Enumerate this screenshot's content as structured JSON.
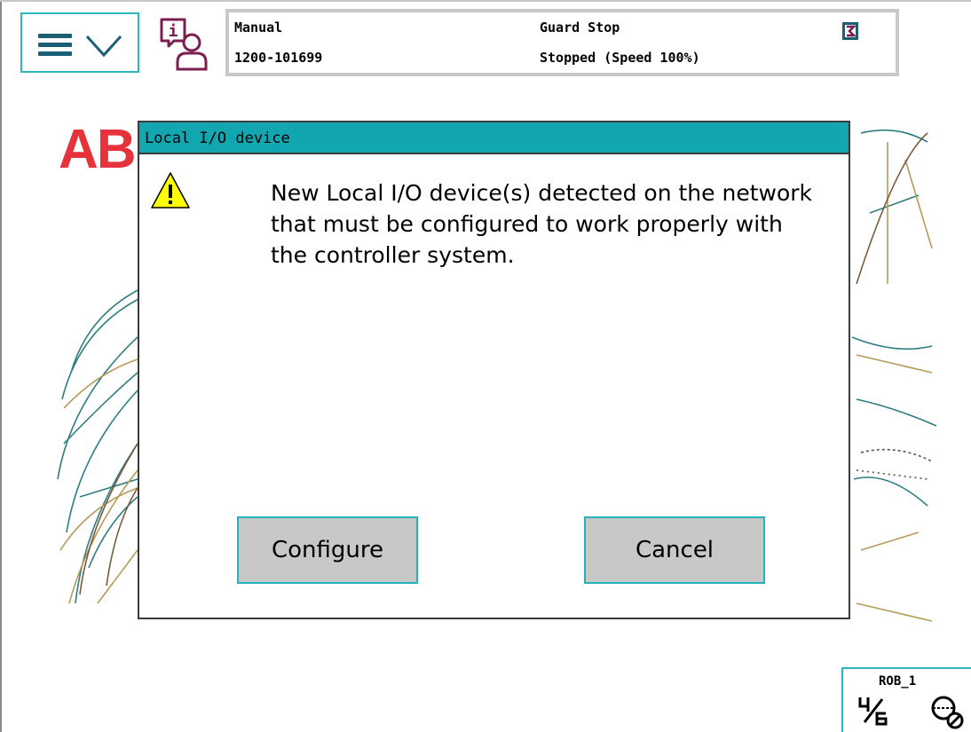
{
  "header": {
    "menu_button": {
      "icon": "hamburger-chevron-icon"
    },
    "info_button": {
      "icon": "info-user-icon"
    },
    "status": {
      "mode": "Manual",
      "system_id": "1200-101699",
      "state": "Guard Stop",
      "motion": "Stopped (Speed 100%)",
      "flag_icon": "status-flag-icon"
    }
  },
  "background": {
    "logo_text": "AB"
  },
  "dialog": {
    "title": "Local I/O device",
    "icon": "warning-icon",
    "message": "New Local I/O device(s) detected on the network that must be configured to work properly with the controller system.",
    "buttons": {
      "configure": "Configure",
      "cancel": "Cancel"
    }
  },
  "robot": {
    "label": "ROB_1",
    "frac_icon": "axes-4-6-icon",
    "mode_icon": "robot-mode-icon"
  },
  "colors": {
    "accent": "#12a7b0",
    "button_border": "#22b3bb",
    "button_fill": "#c8c8c8",
    "logo": "#e5323b",
    "warning": "#ffff00"
  }
}
